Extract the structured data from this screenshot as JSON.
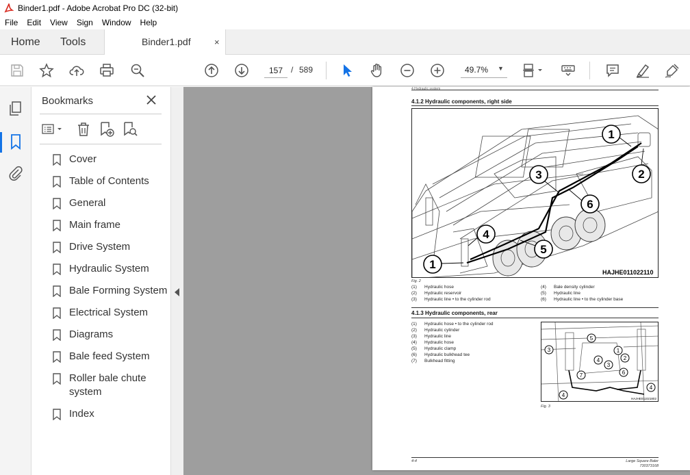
{
  "window": {
    "title": "Binder1.pdf - Adobe Acrobat Pro DC (32-bit)"
  },
  "menu": [
    "File",
    "Edit",
    "View",
    "Sign",
    "Window",
    "Help"
  ],
  "tabs": {
    "home": "Home",
    "tools": "Tools",
    "document": "Binder1.pdf",
    "close": "×"
  },
  "toolbar": {
    "page_current": "157",
    "page_separator": "/",
    "page_total": "589",
    "zoom": "49.7%",
    "zoom_caret": "▼"
  },
  "bookmarks": {
    "title": "Bookmarks",
    "items": [
      "Cover",
      "Table of Contents",
      "General",
      "Main frame",
      "Drive System",
      "Hydraulic System",
      "Bale Forming System",
      "Electrical System",
      "Diagrams",
      "Bale feed System",
      "Roller bale chute system",
      "Index"
    ]
  },
  "document": {
    "header_small": "4 Hydraulic system",
    "section1": {
      "heading": "4.1.2  Hydraulic components, right side",
      "figure_code": "HAJHE011022110",
      "figure_label": "Fig. 2"
    },
    "legend1_left": [
      {
        "num": "(1)",
        "text": "Hydraulic hose"
      },
      {
        "num": "(2)",
        "text": "Hydraulic reservoir"
      },
      {
        "num": "(3)",
        "text": "Hydraulic line • to the cylinder rod"
      }
    ],
    "legend1_right": [
      {
        "num": "(4)",
        "text": "Bale density cylinder"
      },
      {
        "num": "(5)",
        "text": "Hydraulic line"
      },
      {
        "num": "(6)",
        "text": "Hydraulic line • to the cylinder base"
      }
    ],
    "section2": {
      "heading": "4.1.3  Hydraulic components, rear",
      "figure_code": "HAJHE011021802",
      "figure_label": "Fig. 3"
    },
    "legend2": [
      {
        "num": "(1)",
        "text": "Hydraulic hose • to the cylinder rod"
      },
      {
        "num": "(2)",
        "text": "Hydraulic cylinder"
      },
      {
        "num": "(3)",
        "text": "Hydraulic line"
      },
      {
        "num": "(4)",
        "text": "Hydraulic hose"
      },
      {
        "num": "(5)",
        "text": "Hydraulic clamp"
      },
      {
        "num": "(6)",
        "text": "Hydraulic bulkhead tee"
      },
      {
        "num": "(7)",
        "text": "Bulkhead fitting"
      }
    ],
    "fig1_callouts": [
      "1",
      "2",
      "3",
      "6",
      "4",
      "5",
      "1"
    ],
    "fig2_callouts": [
      "5",
      "3",
      "4",
      "1",
      "2",
      "7",
      "3",
      "6",
      "4",
      "4"
    ],
    "footer_left": "4-4",
    "footer_right_line1": "Large Square Baler",
    "footer_right_line2": "730373168"
  }
}
